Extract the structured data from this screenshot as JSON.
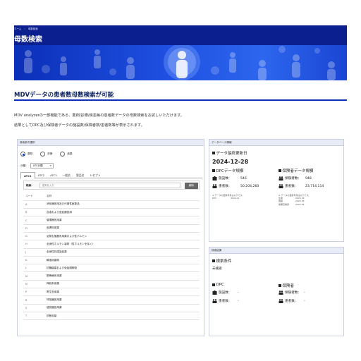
{
  "breadcrumb": [
    "ホーム",
    "母数検索"
  ],
  "page_title": "母数検索",
  "section_title": "MDVデータの患者数母数検索が可能",
  "intro": [
    "MDV analyzerの一部機能である、薬剤/診療/疾患毎の患者数データの母数検索をお試しいただけます。",
    "結果としてDPC及び保険者データの施設数/保険者数/患者数等が表示されます。"
  ],
  "search": {
    "header": "検索条件選択",
    "radios": [
      {
        "label": "薬剤",
        "selected": true
      },
      {
        "label": "診療",
        "selected": false
      },
      {
        "label": "疾患",
        "selected": false
      }
    ],
    "class_label": "分類：",
    "class_value": "ATC分類",
    "tabs": [
      "ATC1",
      "ATC2",
      "ATC3",
      "一般名",
      "製品名",
      "レセプト"
    ],
    "active_tab": 0,
    "keyword_label": "検索：",
    "keyword_placeholder": "語句を入力",
    "clear_button": "解除",
    "columns": [
      "コード",
      "名称"
    ],
    "rows": [
      {
        "code": "A",
        "name": "消化器官用及び代謝性医薬品"
      },
      {
        "code": "B",
        "name": "血液および造血器官用"
      },
      {
        "code": "C",
        "name": "循環器官用薬"
      },
      {
        "code": "D",
        "name": "皮膚科用薬"
      },
      {
        "code": "G",
        "name": "泌尿生殖器系用薬および性ホルモン"
      },
      {
        "code": "H",
        "name": "全身性ホルモン製剤（性ホルモンを除く）"
      },
      {
        "code": "J",
        "name": "全身性抗感染症薬"
      },
      {
        "code": "K",
        "name": "輸液用薬剤"
      },
      {
        "code": "L",
        "name": "抗腫瘍薬および免疫調節剤"
      },
      {
        "code": "M",
        "name": "筋骨格系用薬"
      },
      {
        "code": "N",
        "name": "神経系用薬"
      },
      {
        "code": "P",
        "name": "寄生虫用薬"
      },
      {
        "code": "R",
        "name": "呼吸器官用薬"
      },
      {
        "code": "S",
        "name": "感覚器官用薬"
      },
      {
        "code": "T",
        "name": "診断用薬"
      }
    ]
  },
  "db_info": {
    "header": "データベース情報",
    "last_update_label": "データ最終更新日",
    "last_update": "2024-12-28",
    "dpc": {
      "title": "DPCデータ規模",
      "facility_label": "施設数：",
      "facility_value": "546",
      "patient_label": "患者数：",
      "patient_value": "50,204,260",
      "note_label": "※ データの更新年月は以下です。",
      "note_key": "DPC",
      "note_value": "2024-11"
    },
    "insurer": {
      "title": "保険者データ規模",
      "insurer_label": "保険者数：",
      "insurer_value": "948",
      "patient_label": "患者数：",
      "patient_value": "23,714,114",
      "note_label": "※ データの更新年月は以下です。",
      "notes": [
        {
          "key": "生保",
          "value": "2024-09"
        },
        {
          "key": "国保",
          "value": "2022-05"
        },
        {
          "key": "後期高齢者",
          "value": "2022-05"
        }
      ]
    }
  },
  "results": {
    "header": "検索結果",
    "condition_title": "検索条件",
    "condition_value": "未検索",
    "dpc_title": "DPC",
    "insurer_title": "保険者",
    "facility_label": "施設数：",
    "facility_value": "-",
    "patient_label": "患者数：",
    "patient_value": "-",
    "insurer_label": "保険者数：",
    "insurer_value": "-",
    "insurer_patient_label": "患者数：",
    "insurer_patient_value": "-"
  },
  "colors": {
    "brand_navy": "#0b1f8f",
    "hero_blue": "#1e4fe0",
    "clear_button": "#666666"
  }
}
